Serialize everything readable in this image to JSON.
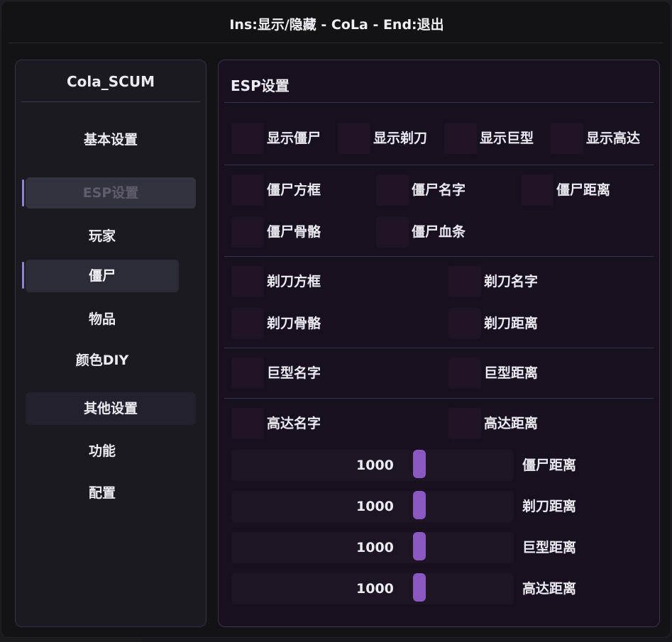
{
  "window": {
    "title": "Ins:显示/隐藏 - CoLa - End:退出"
  },
  "sidebar": {
    "title": "Cola_SCUM",
    "items": [
      {
        "label": "基本设置",
        "kind": "group"
      },
      {
        "label": "ESP设置",
        "kind": "selected"
      },
      {
        "label": "玩家",
        "kind": "item"
      },
      {
        "label": "僵尸",
        "kind": "active"
      },
      {
        "label": "物品",
        "kind": "item"
      },
      {
        "label": "颜色DIY",
        "kind": "item"
      },
      {
        "label": "其他设置",
        "kind": "group"
      },
      {
        "label": "功能",
        "kind": "item"
      },
      {
        "label": "配置",
        "kind": "item"
      }
    ]
  },
  "main": {
    "title": "ESP设置",
    "show_row": [
      "显示僵尸",
      "显示剃刀",
      "显示巨型",
      "显示高达"
    ],
    "zombie_options": [
      "僵尸方框",
      "僵尸名字",
      "僵尸距离",
      "僵尸骨骼",
      "僵尸血条"
    ],
    "razor_options": [
      "剃刀方框",
      "剃刀名字",
      "剃刀骨骼",
      "剃刀距离"
    ],
    "giant_options": [
      "巨型名字",
      "巨型距离"
    ],
    "gundam_options": [
      "高达名字",
      "高达距离"
    ],
    "sliders": [
      {
        "value": "1000",
        "label": "僵尸距离"
      },
      {
        "value": "1000",
        "label": "剃刀距离"
      },
      {
        "value": "1000",
        "label": "巨型距离"
      },
      {
        "value": "1000",
        "label": "高达距离"
      }
    ]
  },
  "colors": {
    "accent": "#8a58c0",
    "indicator": "#8f83d8",
    "panel_bg": "#180f1f"
  }
}
